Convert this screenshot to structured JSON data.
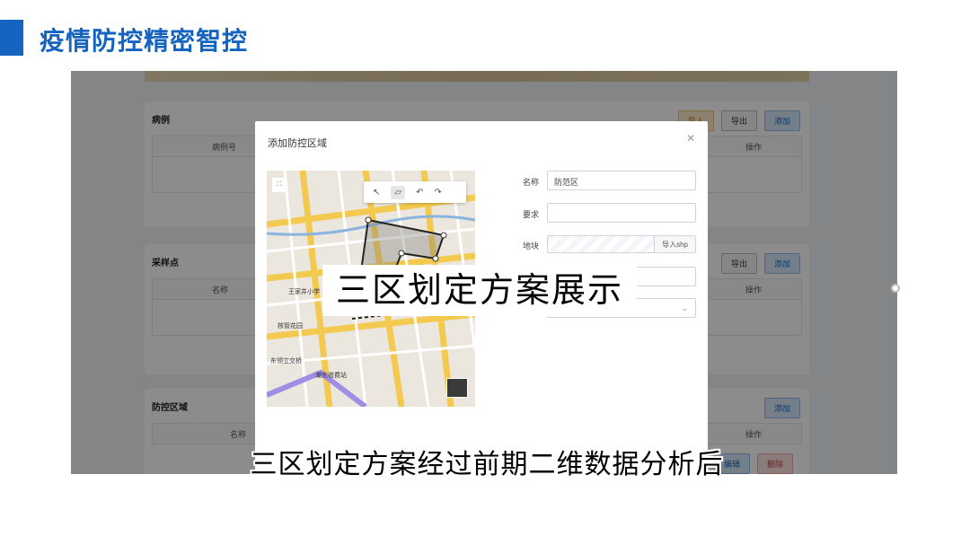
{
  "slide": {
    "title": "疫情防控精密智控",
    "accent_color": "#1565c0"
  },
  "app": {
    "cards": [
      {
        "title": "病例",
        "actions": [
          "导入",
          "导出",
          "添加"
        ],
        "columns": [
          "病例号",
          "操作"
        ]
      },
      {
        "title": "采样点",
        "actions": [
          "导出",
          "添加"
        ],
        "columns": [
          "名称",
          "操作"
        ]
      },
      {
        "title": "防控区域",
        "actions": [
          "添加"
        ],
        "columns": [
          "名称",
          "操作"
        ],
        "row_actions": [
          "编辑",
          "删除"
        ]
      }
    ]
  },
  "modal": {
    "title": "添加防控区域",
    "close_icon": "close-icon",
    "map": {
      "labels": [
        "王家井小学",
        "核管花园",
        "东领立交桥",
        "潮东收费站"
      ],
      "tools": [
        "select-icon",
        "polygon-icon",
        "undo-icon",
        "redo-icon"
      ]
    },
    "form": {
      "name_label": "名称",
      "name_value": "防范区",
      "requirement_label": "要求",
      "requirement_value": "",
      "plot_label": "地块",
      "import_button": "导入shp"
    }
  },
  "overlay": {
    "caption": "三区划定方案展示",
    "subtitle": "三区划定方案经过前期二维数据分析后"
  }
}
